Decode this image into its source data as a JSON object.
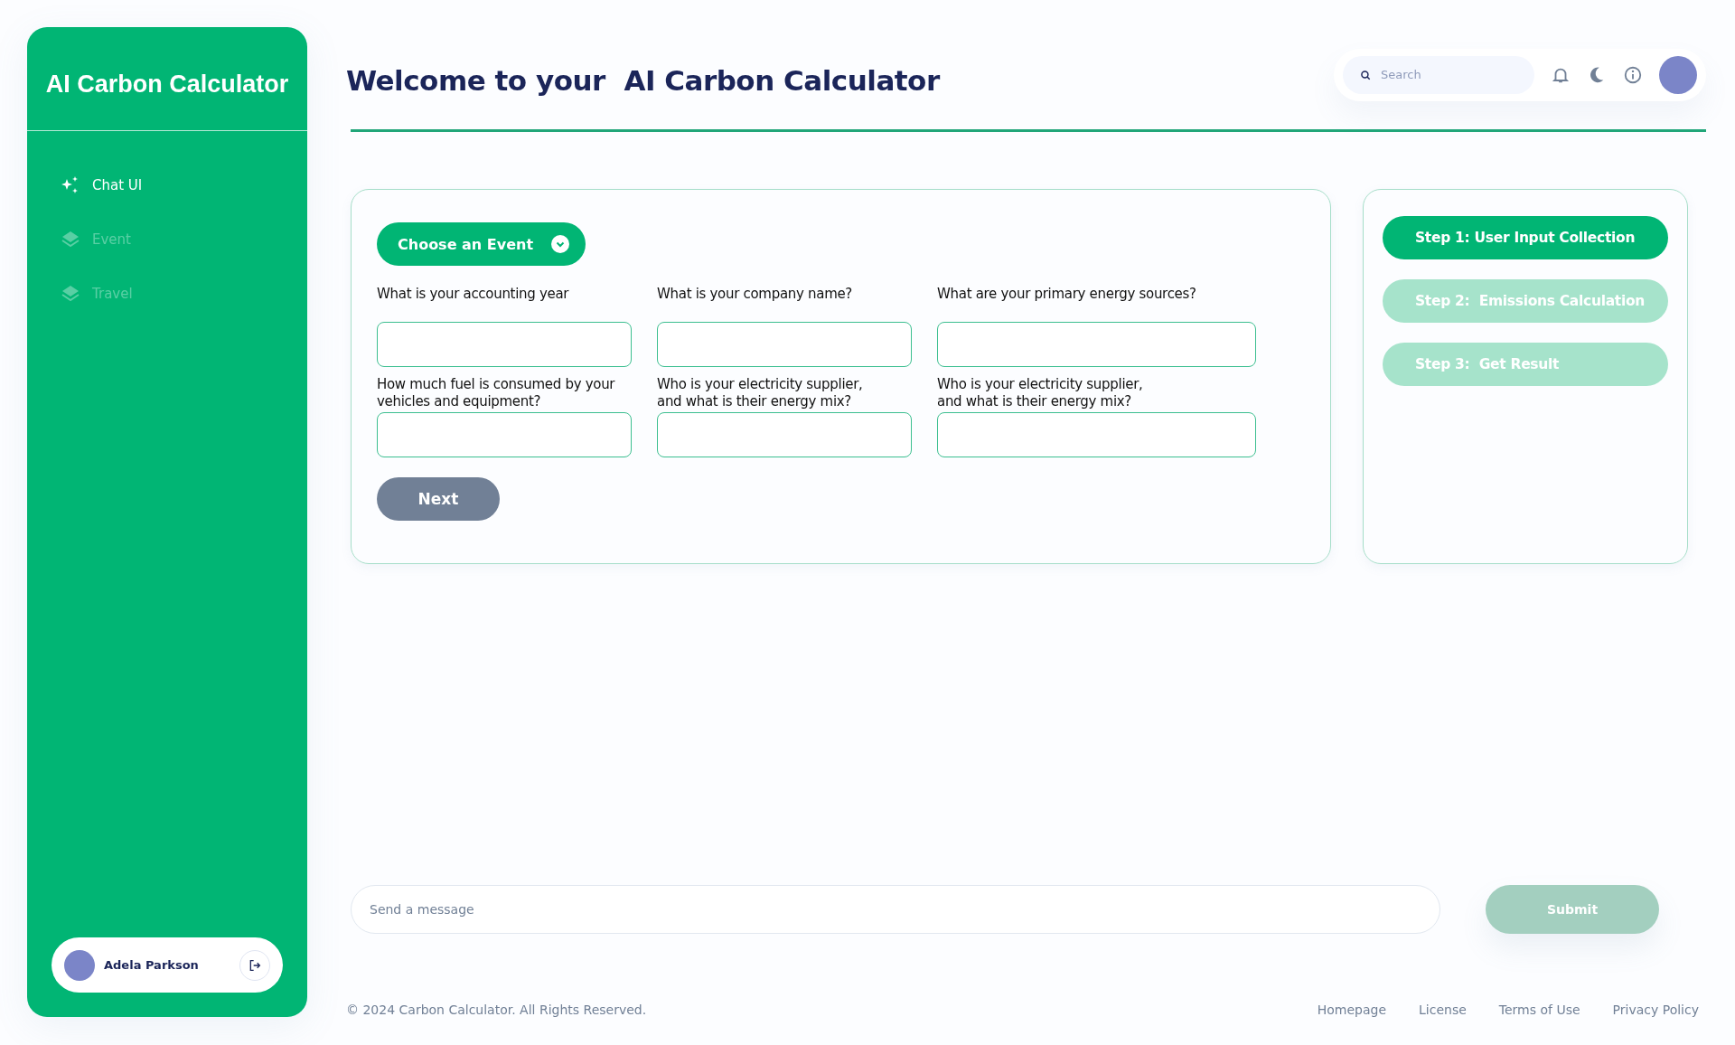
{
  "sidebar": {
    "logo": "AI Carbon Calculator",
    "items": [
      {
        "label": "Chat UI",
        "kind": "sparkle",
        "selected": true
      },
      {
        "label": "Event",
        "kind": "layers",
        "selected": false
      },
      {
        "label": "Travel",
        "kind": "layers",
        "selected": false
      }
    ],
    "user": {
      "name": "Adela Parkson"
    }
  },
  "header": {
    "title": "Welcome to your  AI Carbon Calculator",
    "search": {
      "placeholder": "Search"
    }
  },
  "form": {
    "event_button": "Choose an Event",
    "fields": [
      {
        "label": "What is your accounting year"
      },
      {
        "label": "What is your company name?"
      },
      {
        "label": "What are your primary energy sources?"
      },
      {
        "label": "How much fuel is consumed by your vehicles and equipment?"
      },
      {
        "label": "Who is your electricity supplier,\nand what is their energy mix?"
      },
      {
        "label": "Who is your electricity supplier,\nand what is their energy mix?"
      }
    ],
    "next_button": "Next"
  },
  "steps": [
    {
      "label": "Step 1: User Input Collection",
      "selected": true
    },
    {
      "label": "Step 2:  Emissions Calculation",
      "selected": false
    },
    {
      "label": "Step 3:  Get Result",
      "selected": false
    }
  ],
  "message": {
    "placeholder": "Send a message",
    "submit": "Submit"
  },
  "footer": {
    "copyright": "© 2024 Carbon Calculator. All Rights Reserved.",
    "links": [
      "Homepage",
      "License",
      "Terms of Use",
      "Privacy Policy"
    ]
  }
}
